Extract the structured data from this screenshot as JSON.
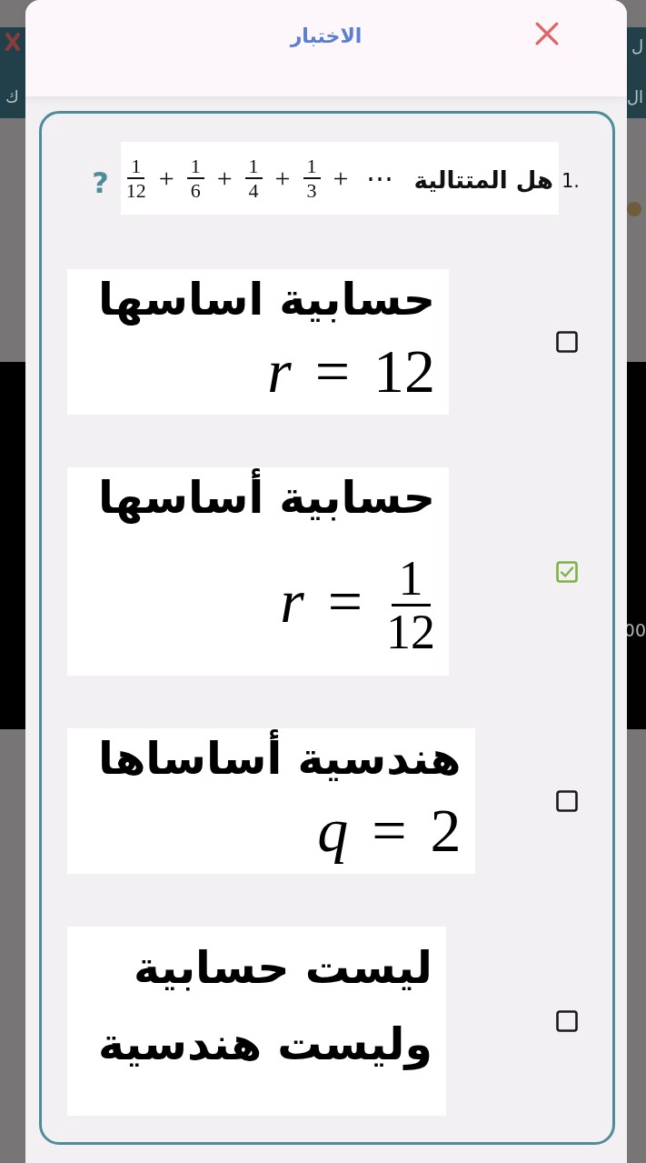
{
  "background": {
    "header": {
      "left_text": "ك",
      "right_lines": [
        "ل",
        "ال"
      ]
    },
    "media_block": {
      "text": "00"
    }
  },
  "dialog": {
    "title": "الاختبار",
    "question": {
      "number": "1.",
      "text": "هل المتتالية",
      "formula": [
        {
          "kind": "op",
          "text": "⋯"
        },
        {
          "kind": "op",
          "text": "+"
        },
        {
          "kind": "frac",
          "num": "1",
          "den": "3"
        },
        {
          "kind": "op",
          "text": "+"
        },
        {
          "kind": "frac",
          "num": "1",
          "den": "4"
        },
        {
          "kind": "op",
          "text": "+"
        },
        {
          "kind": "frac",
          "num": "1",
          "den": "6"
        },
        {
          "kind": "op",
          "text": "+"
        },
        {
          "kind": "frac",
          "num": "1",
          "den": "12"
        }
      ],
      "mark": "?"
    },
    "options": [
      {
        "lines": [
          {
            "kind": "text",
            "text": "حسابية اساسها"
          },
          {
            "kind": "math",
            "tokens": [
              {
                "kind": "num",
                "text": "12"
              },
              {
                "kind": "op",
                "text": "="
              },
              {
                "kind": "var",
                "text": "r"
              }
            ]
          }
        ],
        "checked": false
      },
      {
        "lines": [
          {
            "kind": "text",
            "text": "حسابية أساسها"
          },
          {
            "kind": "math",
            "tokens": [
              {
                "kind": "frac",
                "num": "1",
                "den": "12"
              },
              {
                "kind": "op",
                "text": "="
              },
              {
                "kind": "var",
                "text": "r"
              }
            ]
          }
        ],
        "checked": true
      },
      {
        "lines": [
          {
            "kind": "text",
            "text": "هندسية أساساها"
          },
          {
            "kind": "math",
            "tokens": [
              {
                "kind": "num",
                "text": "2"
              },
              {
                "kind": "op",
                "text": "="
              },
              {
                "kind": "var",
                "text": "q"
              }
            ]
          }
        ],
        "checked": false
      },
      {
        "lines": [
          {
            "kind": "text",
            "text": "ليست حسابية"
          },
          {
            "kind": "text",
            "text": "وليست هندسية"
          }
        ],
        "checked": false
      }
    ]
  }
}
